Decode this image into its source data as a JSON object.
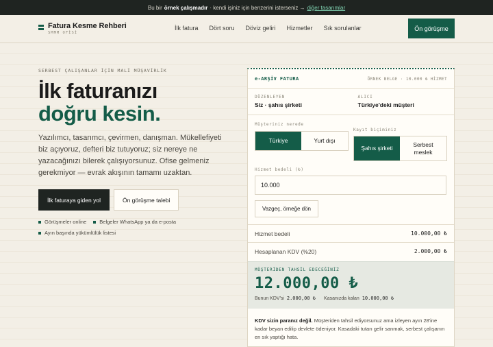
{
  "announcement": {
    "prefix": "Bu bir",
    "bold": "örnek çalışmadır",
    "middle": "· kendi işiniz için benzerini isterseniz →",
    "link": "diğer tasarımlar"
  },
  "brand": {
    "title": "Fatura Kesme Rehberi",
    "subtitle": "SMMM OFİSİ",
    "accent": "#145c48"
  },
  "nav": {
    "items": [
      "İlk fatura",
      "Dört soru",
      "Döviz geliri",
      "Hizmetler",
      "Sık sorulanlar"
    ],
    "cta": "Ön görüşme"
  },
  "hero": {
    "eyebrow": "SERBEST ÇALIŞANLAR İÇİN MALİ MÜŞAVİRLİK",
    "title_line1": "İlk faturanızı",
    "title_line2": "doğru kesin.",
    "lead": "Yazılımcı, tasarımcı, çevirmen, danışman. Mükellefiyeti biz açıyoruz, defteri biz tutuyoruz; siz nereye ne yazacağınızı bilerek çalışıyorsunuz. Ofise gelmeniz gerekmiyor — evrak akışının tamamı uzaktan.",
    "primary_button": "İlk faturaya giden yol",
    "secondary_button": "Ön görüşme talebi",
    "bullets": [
      "Görüşmeler online",
      "Belgeler WhatsApp ya da e-posta",
      "Ayın başında yükümlülük listesi"
    ]
  },
  "invoice": {
    "header_title": "e-ARŞİV FATURA",
    "header_meta": "ÖRNEK BELGE · 10.000 ₺ HİZMET",
    "issuer_label": "DÜZENLEYEN",
    "issuer_value": "Siz · şahıs şirketi",
    "buyer_label": "ALICI",
    "buyer_value": "Türkiye'deki müşteri",
    "customer_location_label": "Müşteriniz nerede",
    "customer_location_options": [
      "Türkiye",
      "Yurt dışı"
    ],
    "customer_location_selected": "Türkiye",
    "registration_label": "Kayıt biçiminiz",
    "registration_options": [
      "Şahıs şirketi",
      "Serbest meslek"
    ],
    "registration_selected": "Şahıs şirketi",
    "amount_label": "Hizmet bedeli (₺)",
    "amount_value": "10.000",
    "reset_button": "Vazgeç, örneğe dön",
    "service_fee_label": "Hizmet bedeli",
    "service_fee_value": "10.000,00 ₺",
    "vat_label": "Hesaplanan KDV (%20)",
    "vat_value": "2.000,00 ₺",
    "total_label": "MÜŞTERİDEN TAHSİL EDECEĞİNİZ",
    "total_value": "12.000,00 ₺",
    "vat_part_label": "Bunun KDV'si",
    "vat_part_value": "2.000,00 ₺",
    "kept_label": "Kasanızda kalan",
    "kept_value": "10.000,00 ₺",
    "note_bold": "KDV sizin paranız değil.",
    "note_text": "Müşteriden tahsil ediyorsunuz ama izleyen ayın 28'ine kadar beyan edilip devlete ödeniyor. Kasadaki tutarı gelir sanmak, serbest çalışanın en sık yaptığı hata."
  }
}
